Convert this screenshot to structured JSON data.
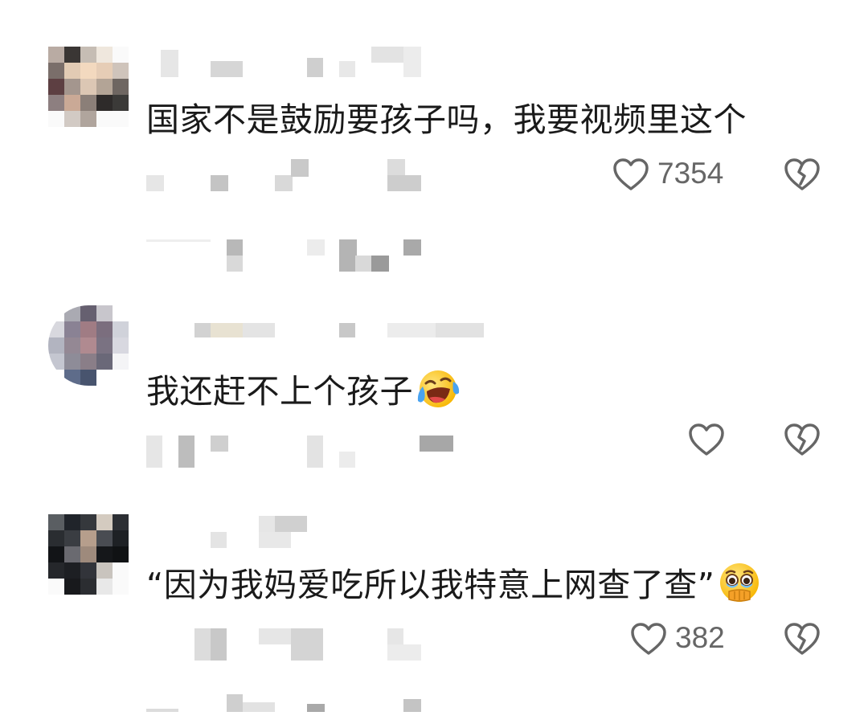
{
  "colors": {
    "text": "#1a1a1a",
    "icon": "#666666",
    "page": "#ffffff"
  },
  "comments": [
    {
      "text": "国家不是鼓励要孩子吗，我要视频里这个",
      "emoji": "",
      "likes": "7354"
    },
    {
      "text": "我还赶不上个孩子",
      "emoji": "face-with-tears-of-joy",
      "likes": ""
    },
    {
      "text": "“因为我妈爱吃所以我特意上网查了查”",
      "emoji": "face-holding-back-tears",
      "likes": "382"
    }
  ]
}
